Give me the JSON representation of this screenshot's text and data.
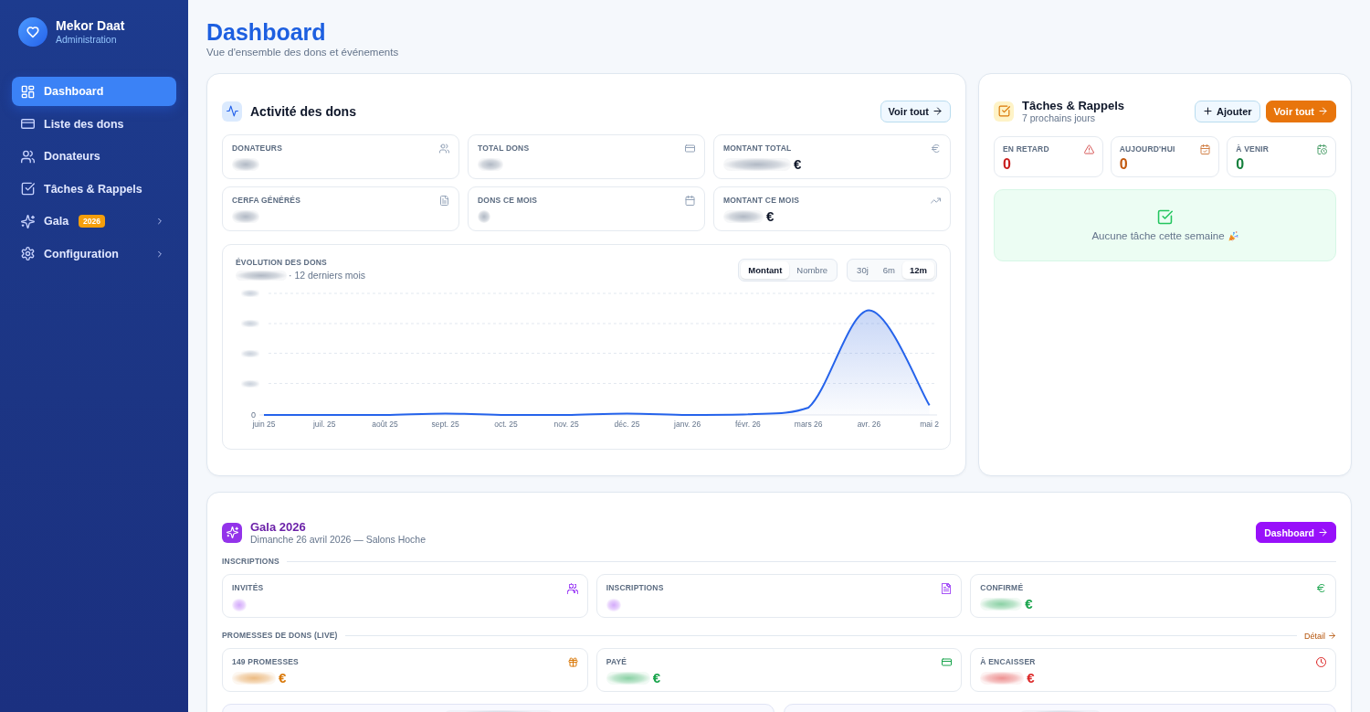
{
  "sidebar": {
    "brand": {
      "name": "Mekor Daat",
      "subtitle": "Administration"
    },
    "items": [
      {
        "label": "Dashboard",
        "selected": true,
        "kind": "link"
      },
      {
        "label": "Liste des dons",
        "selected": false,
        "kind": "link"
      },
      {
        "label": "Donateurs",
        "selected": false,
        "kind": "link"
      },
      {
        "label": "Tâches & Rappels",
        "selected": false,
        "kind": "link"
      },
      {
        "label": "Gala",
        "selected": false,
        "kind": "group",
        "badge": "2026",
        "expanded": false
      },
      {
        "label": "Configuration",
        "selected": false,
        "kind": "group",
        "expanded": false
      }
    ]
  },
  "header": {
    "title": "Dashboard",
    "subtitle": "Vue d'ensemble des dons et événements"
  },
  "activity": {
    "title": "Activité des dons",
    "action": "Voir tout",
    "stats": [
      {
        "label": "DONATEURS",
        "masked": true
      },
      {
        "label": "TOTAL DONS",
        "masked": true
      },
      {
        "label": "MONTANT TOTAL",
        "masked": true,
        "unit": "€"
      },
      {
        "label": "CERFA GÉNÉRÉS",
        "masked": true
      },
      {
        "label": "DONS CE MOIS",
        "masked": true
      },
      {
        "label": "MONTANT CE MOIS",
        "masked": true,
        "unit": "€"
      }
    ],
    "trend": {
      "title": "ÉVOLUTION DES DONS",
      "total_masked": true,
      "period": "· 12 derniers mois",
      "metrics": [
        {
          "label": "Montant",
          "selected": true
        },
        {
          "label": "Nombre",
          "selected": false
        }
      ],
      "ranges": [
        {
          "label": "30j",
          "selected": false
        },
        {
          "label": "6m",
          "selected": false
        },
        {
          "label": "12m",
          "selected": true
        }
      ],
      "y_ticks": [
        {
          "masked": true
        },
        {
          "masked": true
        },
        {
          "masked": true
        },
        {
          "masked": true
        },
        {
          "label": "0"
        }
      ],
      "x_labels": [
        "juin 25",
        "juil. 25",
        "août 25",
        "sept. 25",
        "oct. 25",
        "nov. 25",
        "déc. 25",
        "janv. 26",
        "févr. 26",
        "mars 26",
        "avr. 26",
        "mai 2"
      ]
    }
  },
  "tasks": {
    "title": "Tâches & Rappels",
    "subtitle": "7 prochains jours",
    "buttons": [
      {
        "label": "Ajouter",
        "kind": "add"
      },
      {
        "label": "Voir tout",
        "kind": "primary"
      }
    ],
    "counters": [
      {
        "label": "EN RETARD",
        "value": "0",
        "color": "#c81e1e"
      },
      {
        "label": "AUJOURD'HUI",
        "value": "0",
        "color": "#c2570c"
      },
      {
        "label": "À VENIR",
        "value": "0",
        "color": "#15803d"
      }
    ],
    "empty_message": "Aucune tâche cette semaine"
  },
  "gala": {
    "title": "Gala 2026",
    "subtitle": "Dimanche 26 avril 2026 — Salons Hoche",
    "action": "Dashboard",
    "sections": [
      {
        "title": "INSCRIPTIONS",
        "stats": [
          {
            "label": "INVITÉS",
            "masked": true,
            "color": "#a855f7"
          },
          {
            "label": "INSCRIPTIONS",
            "masked": true,
            "color": "#a855f7"
          },
          {
            "label": "CONFIRMÉ",
            "masked": true,
            "unit": "€",
            "color": "#16a34a"
          }
        ]
      },
      {
        "title": "PROMESSES DE DONS (LIVE)",
        "link": "Détail",
        "stats": [
          {
            "label": "149 PROMESSES",
            "masked": true,
            "unit": "€",
            "color": "#d97706"
          },
          {
            "label": "PAYÉ",
            "masked": true,
            "unit": "€",
            "color": "#16a34a"
          },
          {
            "label": "À ENCAISSER",
            "masked": true,
            "unit": "€",
            "color": "#dc2626"
          }
        ]
      }
    ],
    "summary_cards": [
      {
        "masked": true
      },
      {
        "masked": true
      }
    ]
  }
}
